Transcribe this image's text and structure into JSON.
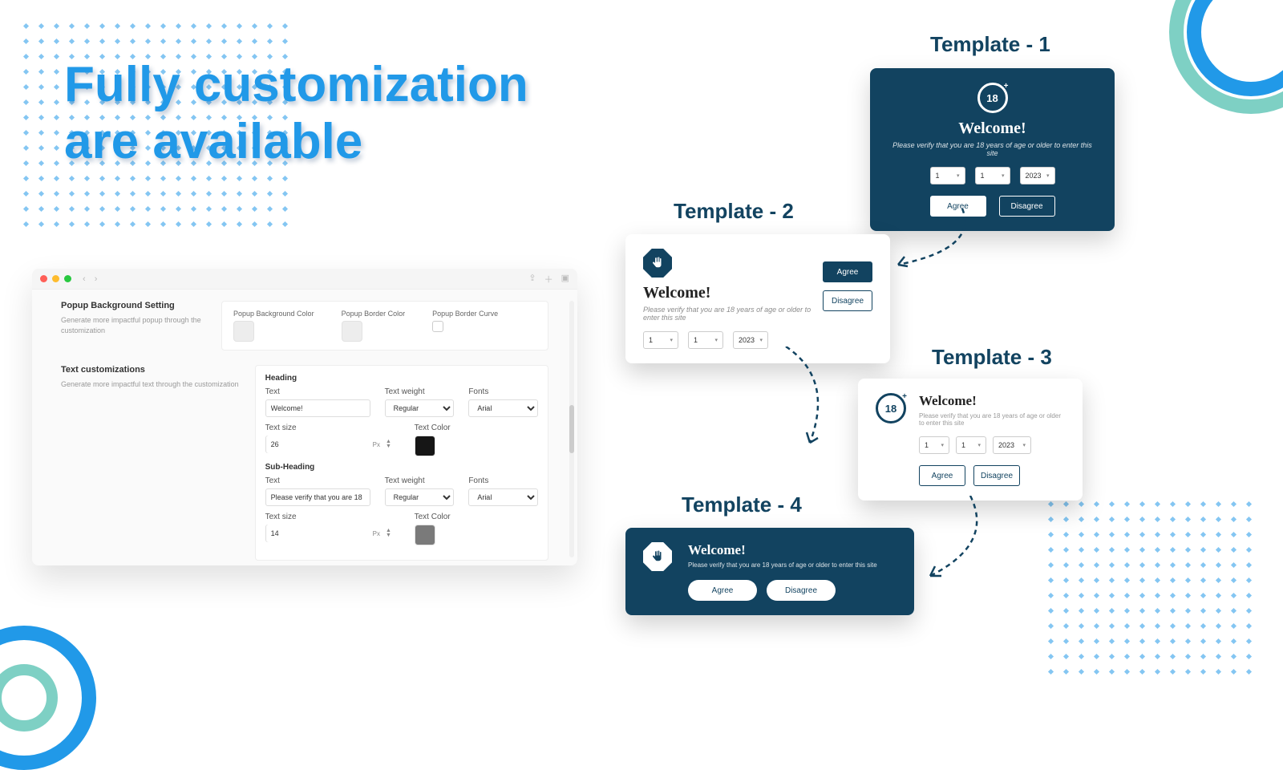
{
  "headline": "Fully customization are available",
  "settings": {
    "section1": {
      "title": "Popup Background Setting",
      "desc": "Generate more impactful popup through the customization",
      "bg_label": "Popup Background Color",
      "border_label": "Popup Border Color",
      "curve_label": "Popup Border Curve"
    },
    "section2": {
      "title": "Text customizations",
      "desc": "Generate more impactful text through the customization",
      "heading_label": "Heading",
      "subheading_label": "Sub-Heading",
      "text_label": "Text",
      "weight_label": "Text weight",
      "fonts_label": "Fonts",
      "size_label": "Text size",
      "color_label": "Text Color",
      "heading_text": "Welcome!",
      "heading_weight": "Regular",
      "heading_font": "Arial",
      "heading_size": "26",
      "sub_text": "Please verify that you are 18",
      "sub_weight": "Regular",
      "sub_font": "Arial",
      "sub_size": "14",
      "unit": "Px"
    }
  },
  "templates": {
    "label1": "Template - 1",
    "label2": "Template - 2",
    "label3": "Template - 3",
    "label4": "Template - 4",
    "welcome": "Welcome!",
    "verify": "Please verify that you are 18 years of age or older to enter this site",
    "day": "1",
    "month": "1",
    "year": "2023",
    "agree": "Agree",
    "disagree": "Disagree",
    "icon18": "18"
  }
}
